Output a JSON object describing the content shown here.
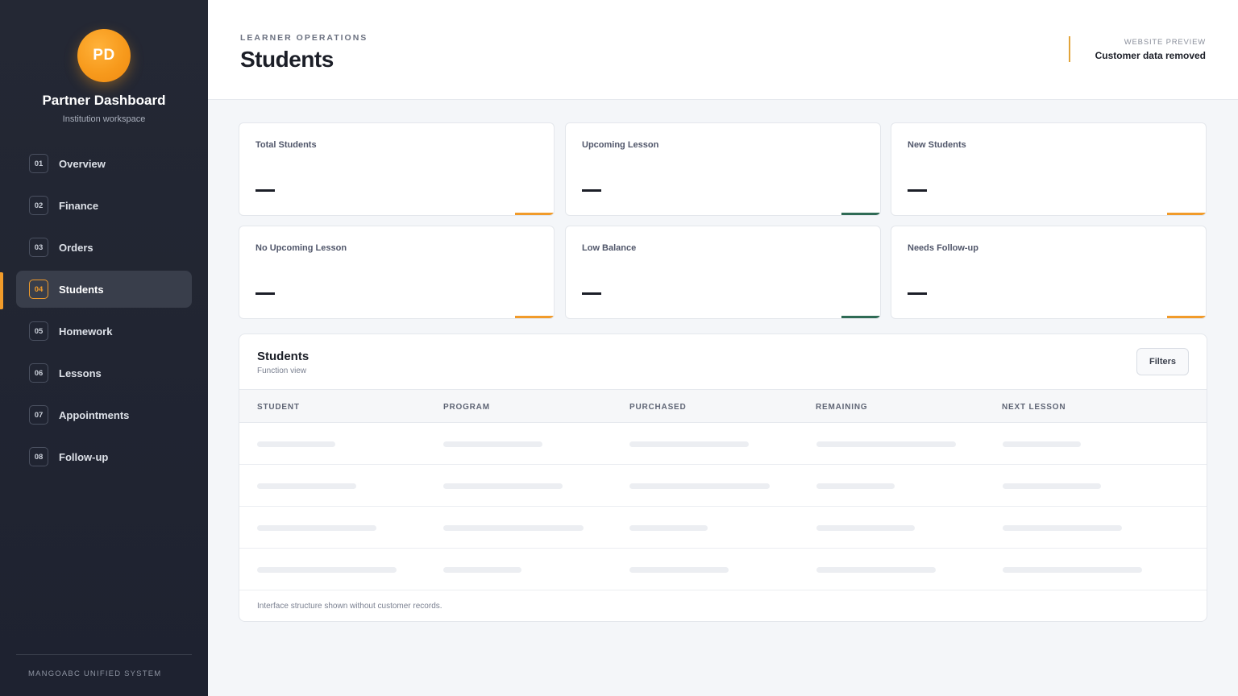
{
  "sidebar": {
    "avatar_initials": "PD",
    "title": "Partner Dashboard",
    "subtitle": "Institution workspace",
    "items": [
      {
        "num": "01",
        "label": "Overview"
      },
      {
        "num": "02",
        "label": "Finance"
      },
      {
        "num": "03",
        "label": "Orders"
      },
      {
        "num": "04",
        "label": "Students",
        "active": true
      },
      {
        "num": "05",
        "label": "Homework"
      },
      {
        "num": "06",
        "label": "Lessons"
      },
      {
        "num": "07",
        "label": "Appointments"
      },
      {
        "num": "08",
        "label": "Follow-up"
      }
    ],
    "footer": "MANGOABC UNIFIED SYSTEM",
    "accent_color": "#f19b2a"
  },
  "header": {
    "eyebrow": "LEARNER OPERATIONS",
    "title": "Students",
    "preview_label": "WEBSITE PREVIEW",
    "preview_value": "Customer data removed"
  },
  "stats": [
    {
      "label": "Total Students",
      "accent": "#f19b2a"
    },
    {
      "label": "Upcoming Lesson",
      "accent": "#2f6b55"
    },
    {
      "label": "New Students",
      "accent": "#f19b2a"
    },
    {
      "label": "No Upcoming Lesson",
      "accent": "#f19b2a"
    },
    {
      "label": "Low Balance",
      "accent": "#2f6b55"
    },
    {
      "label": "Needs Follow-up",
      "accent": "#f19b2a"
    }
  ],
  "table": {
    "title": "Students",
    "subtitle": "Function view",
    "filters_label": "Filters",
    "columns": [
      "STUDENT",
      "PROGRAM",
      "PURCHASED",
      "REMAINING",
      "NEXT LESSON"
    ],
    "footer_note": "Interface structure shown without customer records."
  }
}
